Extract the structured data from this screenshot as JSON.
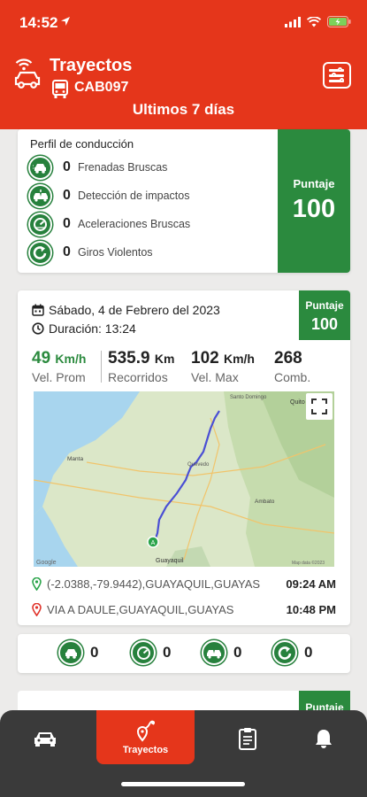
{
  "status_bar": {
    "time": "14:52"
  },
  "header": {
    "title": "Trayectos",
    "vehicle_code": "CAB097",
    "period": "Ultimos 7 días"
  },
  "profile": {
    "title": "Perfil de conducción",
    "items": [
      {
        "count": "0",
        "label": "Frenadas Bruscas",
        "icon": "hard-braking-icon"
      },
      {
        "count": "0",
        "label": "Detección de impactos",
        "icon": "impact-detection-icon"
      },
      {
        "count": "0",
        "label": "Aceleraciones Bruscas",
        "icon": "harsh-acceleration-icon"
      },
      {
        "count": "0",
        "label": "Giros Violentos",
        "icon": "violent-turn-icon"
      }
    ],
    "score_label": "Puntaje",
    "score_value": "100"
  },
  "trip": {
    "date": "Sábado, 4 de Febrero del 2023",
    "duration": "Duración: 13:24",
    "score_label": "Puntaje",
    "score_value": "100",
    "stats": {
      "avg_speed": {
        "value": "49",
        "unit": "Km/h",
        "label": "Vel. Prom"
      },
      "distance": {
        "value": "535.9",
        "unit": "Km",
        "label": "Recorridos"
      },
      "max_speed": {
        "value": "102",
        "unit": "Km/h",
        "label": "Vel. Max"
      },
      "fuel": {
        "value": "268",
        "label": "Comb."
      }
    },
    "map_labels": {
      "santo_domingo": "Santo Domingo",
      "quito": "Quito",
      "manta": "Manta",
      "ambato": "Ambato",
      "quevedo": "Quevedo",
      "guayaquil": "Guayaquil",
      "google": "Google",
      "map_data": "Map data ©2023"
    },
    "start": {
      "location": "(-2.0388,-79.9442),GUAYAQUIL,GUAYAS",
      "time": "09:24 AM"
    },
    "end": {
      "location": "VIA A DAULE,GUAYAQUIL,GUAYAS",
      "time": "10:48 PM"
    },
    "events": [
      {
        "icon": "hard-braking-icon",
        "count": "0"
      },
      {
        "icon": "harsh-acceleration-icon",
        "count": "0"
      },
      {
        "icon": "impact-detection-icon",
        "count": "0"
      },
      {
        "icon": "violent-turn-icon",
        "count": "0"
      }
    ]
  },
  "next_card": {
    "score_label": "Puntaje"
  },
  "tabbar": {
    "items": [
      {
        "icon": "car-icon",
        "label": ""
      },
      {
        "icon": "route-icon",
        "label": "Trayectos",
        "active": true
      },
      {
        "icon": "clipboard-icon",
        "label": ""
      },
      {
        "icon": "bell-icon",
        "label": ""
      }
    ]
  },
  "colors": {
    "brand_red": "#e5361b",
    "score_green": "#2b8a3e",
    "tabbar": "#3a3a3a"
  }
}
